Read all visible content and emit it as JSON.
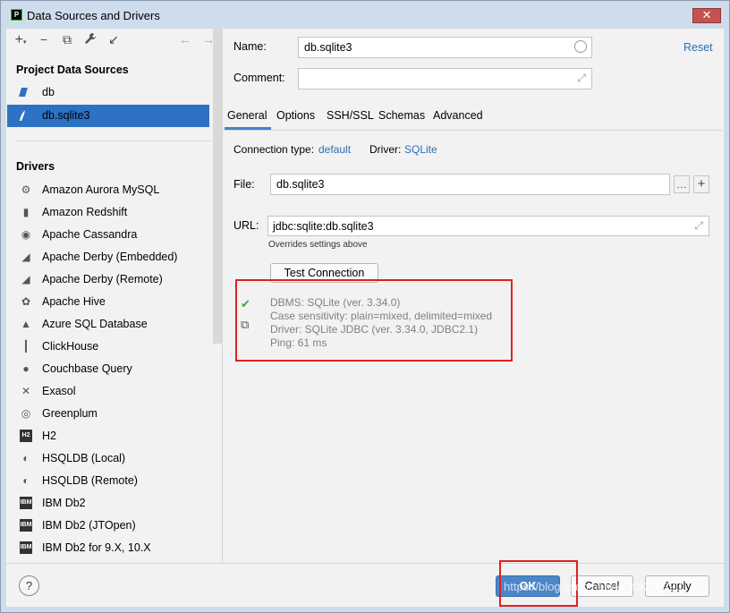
{
  "window": {
    "title": "Data Sources and Drivers",
    "close_glyph": "✕"
  },
  "toolbar": {
    "add": "+",
    "add_arrow": "▾",
    "remove": "−",
    "copy": "⧉",
    "wrench": "🔧",
    "import": "↙",
    "back": "←",
    "forward": "→"
  },
  "project": {
    "header": "Project Data Sources",
    "items": [
      {
        "label": "db",
        "selected": false
      },
      {
        "label": "db.sqlite3",
        "selected": true
      }
    ]
  },
  "drivers": {
    "header": "Drivers",
    "items": [
      {
        "label": "Amazon Aurora MySQL",
        "icon": "aurora-icon",
        "glyph": "⚙"
      },
      {
        "label": "Amazon Redshift",
        "icon": "redshift-icon",
        "glyph": "▮"
      },
      {
        "label": "Apache Cassandra",
        "icon": "cassandra-icon",
        "glyph": "◉"
      },
      {
        "label": "Apache Derby (Embedded)",
        "icon": "derby-icon",
        "glyph": "◢"
      },
      {
        "label": "Apache Derby (Remote)",
        "icon": "derby-icon",
        "glyph": "◢"
      },
      {
        "label": "Apache Hive",
        "icon": "hive-icon",
        "glyph": "✿"
      },
      {
        "label": "Azure SQL Database",
        "icon": "azure-icon",
        "glyph": "▲"
      },
      {
        "label": "ClickHouse",
        "icon": "clickhouse-icon",
        "glyph": "┃"
      },
      {
        "label": "Couchbase Query",
        "icon": "couchbase-icon",
        "glyph": "●"
      },
      {
        "label": "Exasol",
        "icon": "exasol-icon",
        "glyph": "✕"
      },
      {
        "label": "Greenplum",
        "icon": "greenplum-icon",
        "glyph": "◎"
      },
      {
        "label": "H2",
        "icon": "h2-icon",
        "glyph": "H2"
      },
      {
        "label": "HSQLDB (Local)",
        "icon": "hsqldb-icon",
        "glyph": "◐"
      },
      {
        "label": "HSQLDB (Remote)",
        "icon": "hsqldb-icon",
        "glyph": "◐"
      },
      {
        "label": "IBM Db2",
        "icon": "ibm-icon",
        "glyph": "IBM"
      },
      {
        "label": "IBM Db2 (JTOpen)",
        "icon": "ibm-icon",
        "glyph": "IBM"
      },
      {
        "label": "IBM Db2 for 9.X, 10.X",
        "icon": "ibm-icon",
        "glyph": "IBM"
      }
    ]
  },
  "form": {
    "name_label": "Name:",
    "name_value": "db.sqlite3",
    "comment_label": "Comment:",
    "comment_value": "",
    "reset": "Reset",
    "expand_glyph": "⤢"
  },
  "tabs": [
    "General",
    "Options",
    "SSH/SSL",
    "Schemas",
    "Advanced"
  ],
  "general": {
    "conn_type_label": "Connection type:",
    "conn_type_value": "default",
    "driver_label": "Driver:",
    "driver_value": "SQLite",
    "file_label": "File:",
    "file_value": "db.sqlite3",
    "ellipsis": "…",
    "plus": "+",
    "url_label": "URL:",
    "url_value": "jdbc:sqlite:db.sqlite3",
    "overrides": "Overrides settings above",
    "test_button": "Test Connection",
    "check_glyph": "✔",
    "copy_glyph": "⧉",
    "result_lines": [
      "DBMS: SQLite (ver. 3.34.0)",
      "Case sensitivity: plain=mixed, delimited=mixed",
      "Driver: SQLite JDBC (ver. 3.34.0, JDBC2.1)",
      "Ping: 61 ms"
    ]
  },
  "footer": {
    "help": "?",
    "ok": "OK",
    "cancel": "Cancel",
    "apply": "Apply",
    "watermark": "https://blog.csdn.net/qq_49236390"
  },
  "colors": {
    "selection": "#2d72c4",
    "link": "#2d6fb5",
    "highlight": "#e02020",
    "ok_button": "#4a86c8",
    "success": "#3aa83a"
  }
}
